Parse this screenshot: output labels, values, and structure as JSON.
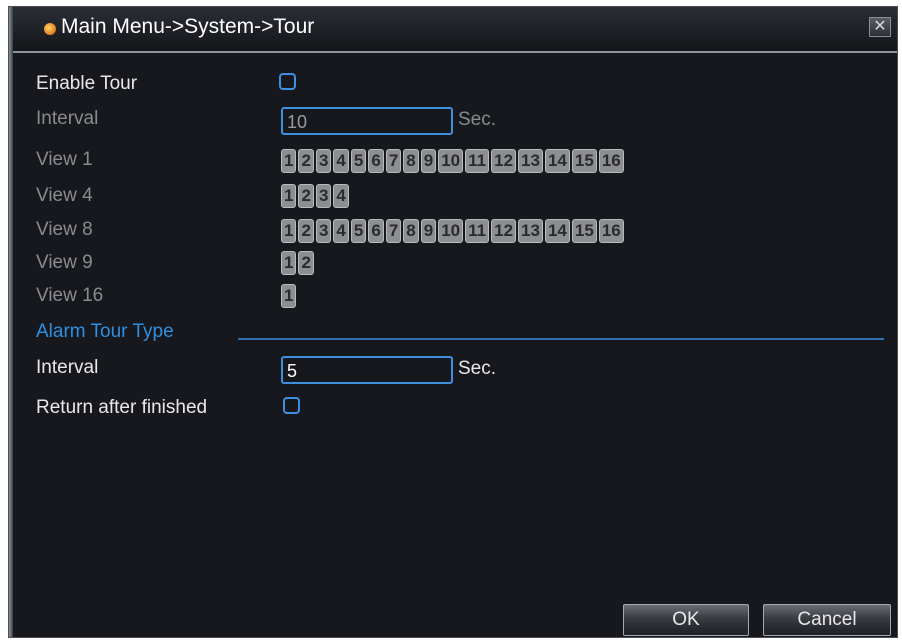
{
  "window": {
    "title": "Main Menu->System->Tour",
    "close_glyph": "✕"
  },
  "enable_tour": {
    "label": "Enable Tour",
    "checked": false
  },
  "interval": {
    "label": "Interval",
    "value": "10",
    "unit": "Sec."
  },
  "views": [
    {
      "label": "View 1",
      "channels": [
        "1",
        "2",
        "3",
        "4",
        "5",
        "6",
        "7",
        "8",
        "9",
        "10",
        "11",
        "12",
        "13",
        "14",
        "15",
        "16"
      ]
    },
    {
      "label": "View 4",
      "channels": [
        "1",
        "2",
        "3",
        "4"
      ]
    },
    {
      "label": "View 8",
      "channels": [
        "1",
        "2",
        "3",
        "4",
        "5",
        "6",
        "7",
        "8",
        "9",
        "10",
        "11",
        "12",
        "13",
        "14",
        "15",
        "16"
      ]
    },
    {
      "label": "View 9",
      "channels": [
        "1",
        "2"
      ]
    },
    {
      "label": "View 16",
      "channels": [
        "1"
      ]
    }
  ],
  "alarm_tour": {
    "section_label": "Alarm Tour Type",
    "interval_label": "Interval",
    "interval_value": "5",
    "interval_unit": "Sec.",
    "return_label": "Return after finished",
    "return_checked": false
  },
  "buttons": {
    "ok": "OK",
    "cancel": "Cancel"
  },
  "colors": {
    "accent": "#3f8fe0",
    "background": "#17181d",
    "chip": "#8d8e91"
  }
}
